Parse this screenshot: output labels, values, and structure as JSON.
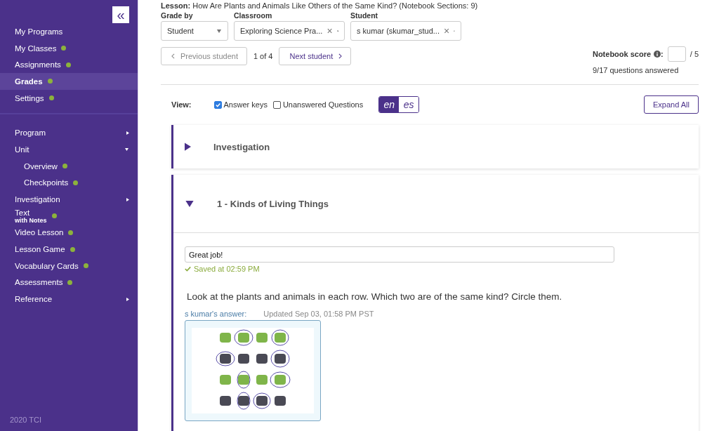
{
  "sidebar": {
    "collapse_button": "«",
    "items": [
      {
        "label": "My Programs",
        "dot": false,
        "selected": false
      },
      {
        "label": "My Classes",
        "dot": true,
        "selected": false
      },
      {
        "label": "Assignments",
        "dot": true,
        "selected": false
      },
      {
        "label": "Grades",
        "dot": true,
        "selected": true
      },
      {
        "label": "Settings",
        "dot": true,
        "selected": false
      }
    ],
    "nav": [
      {
        "label": "Program",
        "dot": false,
        "expanded": false
      },
      {
        "label": "Unit",
        "dot": false,
        "expanded": true,
        "children": [
          {
            "label": "Overview",
            "dot": true
          },
          {
            "label": "Checkpoints",
            "dot": true
          }
        ]
      },
      {
        "label": "Investigation",
        "dot": false,
        "expanded": false
      },
      {
        "label": "Text",
        "sublabel": "with Notes",
        "dot": true
      },
      {
        "label": "Video Lesson",
        "dot": true
      },
      {
        "label": "Lesson Game",
        "dot": true
      },
      {
        "label": "Vocabulary Cards",
        "dot": true
      },
      {
        "label": "Assessments",
        "dot": true
      },
      {
        "label": "Reference",
        "dot": false,
        "expanded": false
      }
    ],
    "footer": "2020 TCI"
  },
  "lesson": "**Lesson:** How Are Plants and Animals Like Others of the Same Kind? (Notebook Sections: 9)",
  "filters": [
    {
      "label": "Grade by",
      "value": "Student"
    },
    {
      "label": "Classroom",
      "value": "Exploring Science Pra...",
      "clear": "×"
    },
    {
      "label": "Student",
      "value": "s kumar (skumar_stud...",
      "clear": "×"
    }
  ],
  "pager": {
    "previous": "Previous student",
    "count": "1 of 4",
    "next": "Next student",
    "previous_disabled": true
  },
  "notebook_score": {
    "label": "Notebook score",
    "colon": ":",
    "max": "/ 5",
    "answered": "9/17 questions answered"
  },
  "view": {
    "label": "View:",
    "options": [
      {
        "label": "Answer keys",
        "checked": true
      },
      {
        "label": "Unanswered Questions",
        "checked": false
      }
    ],
    "languages": [
      {
        "label": "en",
        "selected": true
      },
      {
        "label": "es",
        "selected": false
      }
    ],
    "expand_all": "Expand All"
  },
  "sections": [
    {
      "title": "Investigation",
      "expanded": false
    },
    {
      "title": "1 - Kinds of Living Things",
      "expanded": true,
      "comment": "Great job!",
      "saved": "Saved at 02:59 PM",
      "question": "Look at the plants and animals in each row. Which two are of the same kind? Circle them.",
      "answer_label": "s kumar's answer:",
      "updated": "Updated Sep 03, 01:58 PM PST"
    }
  ]
}
